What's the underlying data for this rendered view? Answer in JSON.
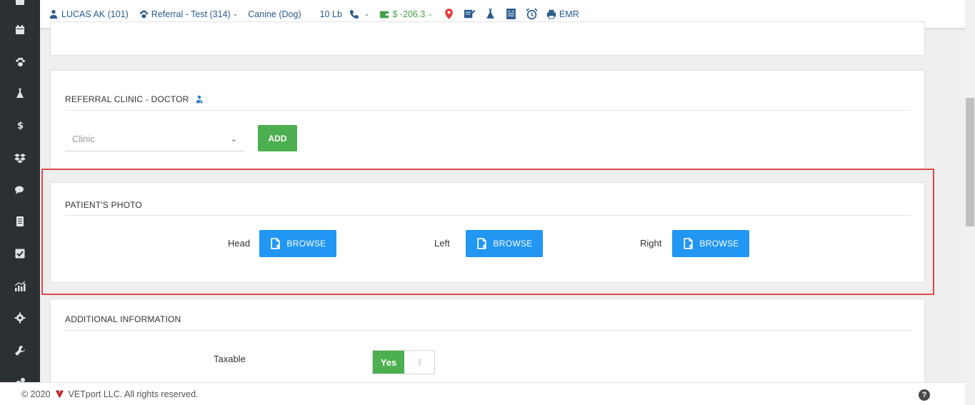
{
  "topbar": {
    "patient": "LUCAS AK (101)",
    "referral": "Referral - Test (314)",
    "species": "Canine (Dog)",
    "weight": "10 Lb",
    "balance": "$ -206.3",
    "emr": "EMR"
  },
  "referral": {
    "title": "REFERRAL CLINIC - DOCTOR",
    "clinic_placeholder": "Clinic",
    "add_label": "ADD"
  },
  "photo": {
    "title": "PATIENT'S PHOTO",
    "head_label": "Head",
    "left_label": "Left",
    "right_label": "Right",
    "browse_label": "BROWSE"
  },
  "additional": {
    "title": "ADDITIONAL INFORMATION",
    "taxable_label": "Taxable",
    "taxable_value": "Yes"
  },
  "footer": {
    "copyright": "© 2020",
    "company": "VETport LLC. All rights reserved.",
    "help": "?"
  },
  "colors": {
    "accent_blue": "#2196f3",
    "accent_green": "#4caf50",
    "highlight_red": "#e04a4a",
    "sidebar": "#2b3035"
  }
}
